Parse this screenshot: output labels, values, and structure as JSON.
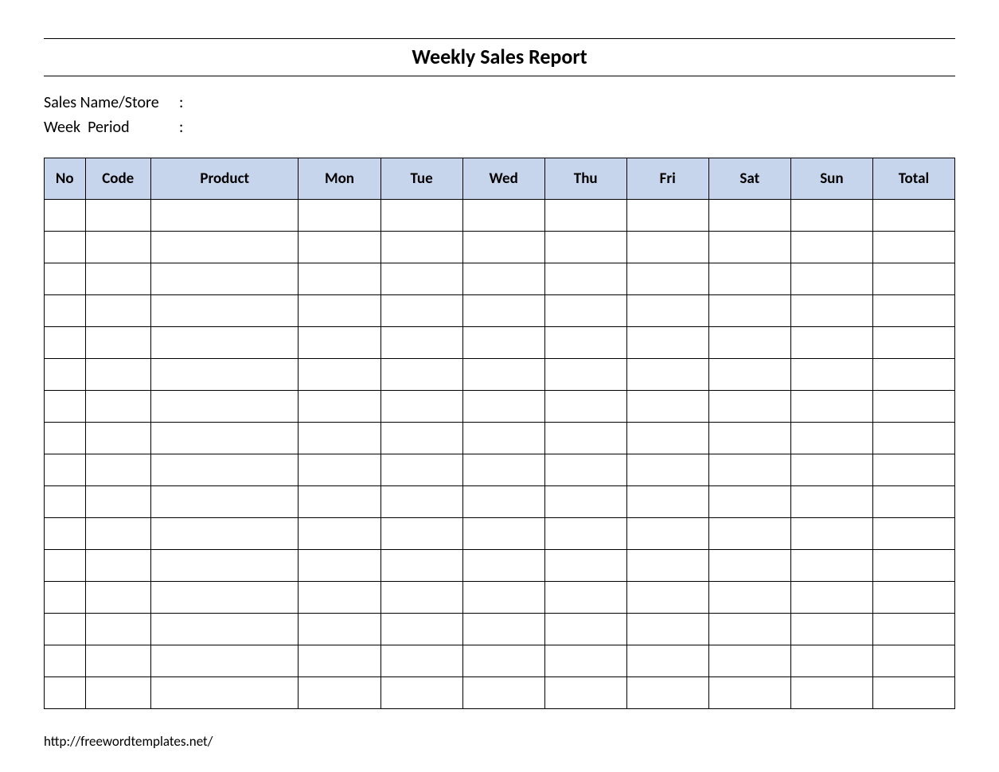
{
  "title": "Weekly Sales Report",
  "meta": {
    "sales_name_label": "Sales Name/Store",
    "sales_name_value": "",
    "week_period_label": "Week  Period",
    "week_period_value": ""
  },
  "table": {
    "headers": {
      "no": "No",
      "code": "Code",
      "product": "Product",
      "mon": "Mon",
      "tue": "Tue",
      "wed": "Wed",
      "thu": "Thu",
      "fri": "Fri",
      "sat": "Sat",
      "sun": "Sun",
      "total": "Total"
    },
    "rows": [
      {
        "no": "",
        "code": "",
        "product": "",
        "mon": "",
        "tue": "",
        "wed": "",
        "thu": "",
        "fri": "",
        "sat": "",
        "sun": "",
        "total": ""
      },
      {
        "no": "",
        "code": "",
        "product": "",
        "mon": "",
        "tue": "",
        "wed": "",
        "thu": "",
        "fri": "",
        "sat": "",
        "sun": "",
        "total": ""
      },
      {
        "no": "",
        "code": "",
        "product": "",
        "mon": "",
        "tue": "",
        "wed": "",
        "thu": "",
        "fri": "",
        "sat": "",
        "sun": "",
        "total": ""
      },
      {
        "no": "",
        "code": "",
        "product": "",
        "mon": "",
        "tue": "",
        "wed": "",
        "thu": "",
        "fri": "",
        "sat": "",
        "sun": "",
        "total": ""
      },
      {
        "no": "",
        "code": "",
        "product": "",
        "mon": "",
        "tue": "",
        "wed": "",
        "thu": "",
        "fri": "",
        "sat": "",
        "sun": "",
        "total": ""
      },
      {
        "no": "",
        "code": "",
        "product": "",
        "mon": "",
        "tue": "",
        "wed": "",
        "thu": "",
        "fri": "",
        "sat": "",
        "sun": "",
        "total": ""
      },
      {
        "no": "",
        "code": "",
        "product": "",
        "mon": "",
        "tue": "",
        "wed": "",
        "thu": "",
        "fri": "",
        "sat": "",
        "sun": "",
        "total": ""
      },
      {
        "no": "",
        "code": "",
        "product": "",
        "mon": "",
        "tue": "",
        "wed": "",
        "thu": "",
        "fri": "",
        "sat": "",
        "sun": "",
        "total": ""
      },
      {
        "no": "",
        "code": "",
        "product": "",
        "mon": "",
        "tue": "",
        "wed": "",
        "thu": "",
        "fri": "",
        "sat": "",
        "sun": "",
        "total": ""
      },
      {
        "no": "",
        "code": "",
        "product": "",
        "mon": "",
        "tue": "",
        "wed": "",
        "thu": "",
        "fri": "",
        "sat": "",
        "sun": "",
        "total": ""
      },
      {
        "no": "",
        "code": "",
        "product": "",
        "mon": "",
        "tue": "",
        "wed": "",
        "thu": "",
        "fri": "",
        "sat": "",
        "sun": "",
        "total": ""
      },
      {
        "no": "",
        "code": "",
        "product": "",
        "mon": "",
        "tue": "",
        "wed": "",
        "thu": "",
        "fri": "",
        "sat": "",
        "sun": "",
        "total": ""
      },
      {
        "no": "",
        "code": "",
        "product": "",
        "mon": "",
        "tue": "",
        "wed": "",
        "thu": "",
        "fri": "",
        "sat": "",
        "sun": "",
        "total": ""
      },
      {
        "no": "",
        "code": "",
        "product": "",
        "mon": "",
        "tue": "",
        "wed": "",
        "thu": "",
        "fri": "",
        "sat": "",
        "sun": "",
        "total": ""
      },
      {
        "no": "",
        "code": "",
        "product": "",
        "mon": "",
        "tue": "",
        "wed": "",
        "thu": "",
        "fri": "",
        "sat": "",
        "sun": "",
        "total": ""
      },
      {
        "no": "",
        "code": "",
        "product": "",
        "mon": "",
        "tue": "",
        "wed": "",
        "thu": "",
        "fri": "",
        "sat": "",
        "sun": "",
        "total": ""
      }
    ]
  },
  "footer": "http://freewordtemplates.net/"
}
